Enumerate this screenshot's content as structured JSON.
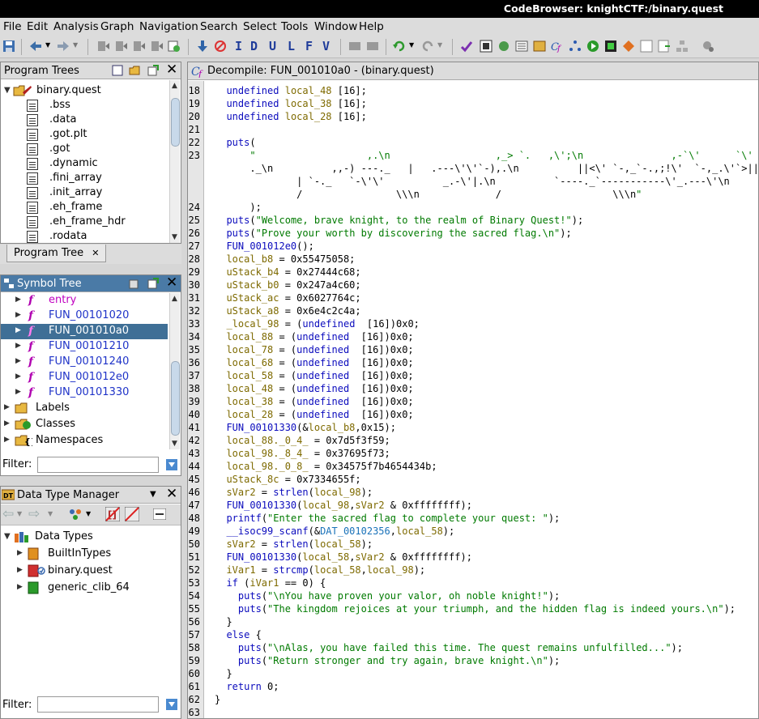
{
  "window": {
    "title": "CodeBrowser: knightCTF:/binary.quest"
  },
  "menu": [
    "File",
    "Edit",
    "Analysis",
    "Graph",
    "Navigation",
    "Search",
    "Select",
    "Tools",
    "Window",
    "Help"
  ],
  "toolbar": {
    "letters": [
      "I",
      "D",
      "U",
      "L",
      "F",
      "V"
    ]
  },
  "program_trees": {
    "title": "Program Trees",
    "root": "binary.quest",
    "items": [
      ".bss",
      ".data",
      ".got.plt",
      ".got",
      ".dynamic",
      ".fini_array",
      ".init_array",
      ".eh_frame",
      ".eh_frame_hdr",
      ".rodata"
    ],
    "tab_label": "Program Tree"
  },
  "symbol_tree": {
    "title": "Symbol Tree",
    "functions": [
      "entry",
      "FUN_00101020",
      "FUN_001010a0",
      "FUN_00101210",
      "FUN_00101240",
      "FUN_001012e0",
      "FUN_00101330"
    ],
    "selected_index": 2,
    "groups": [
      "Labels",
      "Classes",
      "Namespaces"
    ],
    "filter_label": "Filter:",
    "filter_value": ""
  },
  "data_type_manager": {
    "title": "Data Type Manager",
    "root": "Data Types",
    "items": [
      "BuiltInTypes",
      "binary.quest",
      "generic_clib_64"
    ],
    "filter_label": "Filter:",
    "filter_value": ""
  },
  "decompiler": {
    "title": "Decompile: FUN_001010a0 -  (binary.quest)",
    "lines": [
      {
        "n": "18",
        "t": "  undefined local_48 [16];"
      },
      {
        "n": "19",
        "t": "  undefined local_38 [16];"
      },
      {
        "n": "20",
        "t": "  undefined local_28 [16];"
      },
      {
        "n": "21",
        "t": "  "
      },
      {
        "n": "22",
        "t": "  puts("
      },
      {
        "n": "23",
        "t": "      \"                   ,.\\n                  ,_> `.   ,\\';\\n               ,-`\\'      `\\'   `\\'"
      },
      {
        "n": "",
        "t": "      ._\\n          ,,-) ---._   |   .---\\'\\'`-),.\\n          ||<\\' `-,_`-.,;!\\'  `-,_.\\'`>||\\n"
      },
      {
        "n": "",
        "t": "              | `-._   `-\\'\\'          _.-\\'|.\\n          `----._`-----------\\'_.---\\'\\n"
      },
      {
        "n": "",
        "t": "              /                \\\\\\n             /                   \\\\\\n\""
      },
      {
        "n": "24",
        "t": "      );"
      },
      {
        "n": "25",
        "t": "  puts(\"Welcome, brave knight, to the realm of Binary Quest!\");"
      },
      {
        "n": "26",
        "t": "  puts(\"Prove your worth by discovering the sacred flag.\\n\");"
      },
      {
        "n": "27",
        "t": "  FUN_001012e0();"
      },
      {
        "n": "28",
        "t": "  local_b8 = 0x55475058;"
      },
      {
        "n": "29",
        "t": "  uStack_b4 = 0x27444c68;"
      },
      {
        "n": "30",
        "t": "  uStack_b0 = 0x247a4c60;"
      },
      {
        "n": "31",
        "t": "  uStack_ac = 0x6027764c;"
      },
      {
        "n": "32",
        "t": "  uStack_a8 = 0x6e4c2c4a;"
      },
      {
        "n": "33",
        "t": "  _local_98 = (undefined  [16])0x0;"
      },
      {
        "n": "34",
        "t": "  local_88 = (undefined  [16])0x0;"
      },
      {
        "n": "35",
        "t": "  local_78 = (undefined  [16])0x0;"
      },
      {
        "n": "36",
        "t": "  local_68 = (undefined  [16])0x0;"
      },
      {
        "n": "37",
        "t": "  local_58 = (undefined  [16])0x0;"
      },
      {
        "n": "38",
        "t": "  local_48 = (undefined  [16])0x0;"
      },
      {
        "n": "39",
        "t": "  local_38 = (undefined  [16])0x0;"
      },
      {
        "n": "40",
        "t": "  local_28 = (undefined  [16])0x0;"
      },
      {
        "n": "41",
        "t": "  FUN_00101330(&local_b8,0x15);"
      },
      {
        "n": "42",
        "t": "  local_88._0_4_ = 0x7d5f3f59;"
      },
      {
        "n": "43",
        "t": "  local_98._8_4_ = 0x37695f73;"
      },
      {
        "n": "44",
        "t": "  local_98._0_8_ = 0x34575f7b4654434b;"
      },
      {
        "n": "45",
        "t": "  uStack_8c = 0x7334655f;"
      },
      {
        "n": "46",
        "t": "  sVar2 = strlen(local_98);"
      },
      {
        "n": "47",
        "t": "  FUN_00101330(local_98,sVar2 & 0xffffffff);"
      },
      {
        "n": "48",
        "t": "  printf(\"Enter the sacred flag to complete your quest: \");"
      },
      {
        "n": "49",
        "t": "  __isoc99_scanf(&DAT_00102356,local_58);"
      },
      {
        "n": "50",
        "t": "  sVar2 = strlen(local_58);"
      },
      {
        "n": "51",
        "t": "  FUN_00101330(local_58,sVar2 & 0xffffffff);"
      },
      {
        "n": "52",
        "t": "  iVar1 = strcmp(local_58,local_98);"
      },
      {
        "n": "53",
        "t": "  if (iVar1 == 0) {"
      },
      {
        "n": "54",
        "t": "    puts(\"\\nYou have proven your valor, oh noble knight!\");"
      },
      {
        "n": "55",
        "t": "    puts(\"The kingdom rejoices at your triumph, and the hidden flag is indeed yours.\\n\");"
      },
      {
        "n": "56",
        "t": "  }"
      },
      {
        "n": "57",
        "t": "  else {"
      },
      {
        "n": "58",
        "t": "    puts(\"\\nAlas, you have failed this time. The quest remains unfulfilled...\");"
      },
      {
        "n": "59",
        "t": "    puts(\"Return stronger and try again, brave knight.\\n\");"
      },
      {
        "n": "60",
        "t": "  }"
      },
      {
        "n": "61",
        "t": "  return 0;"
      },
      {
        "n": "62",
        "t": "}"
      },
      {
        "n": "63",
        "t": ""
      }
    ]
  },
  "colors": {
    "selection": "#3f6f96",
    "header_active": "#4a7aa6",
    "keyword": "#0b0bbd",
    "string": "#007a00",
    "variable": "#7e6a00"
  }
}
